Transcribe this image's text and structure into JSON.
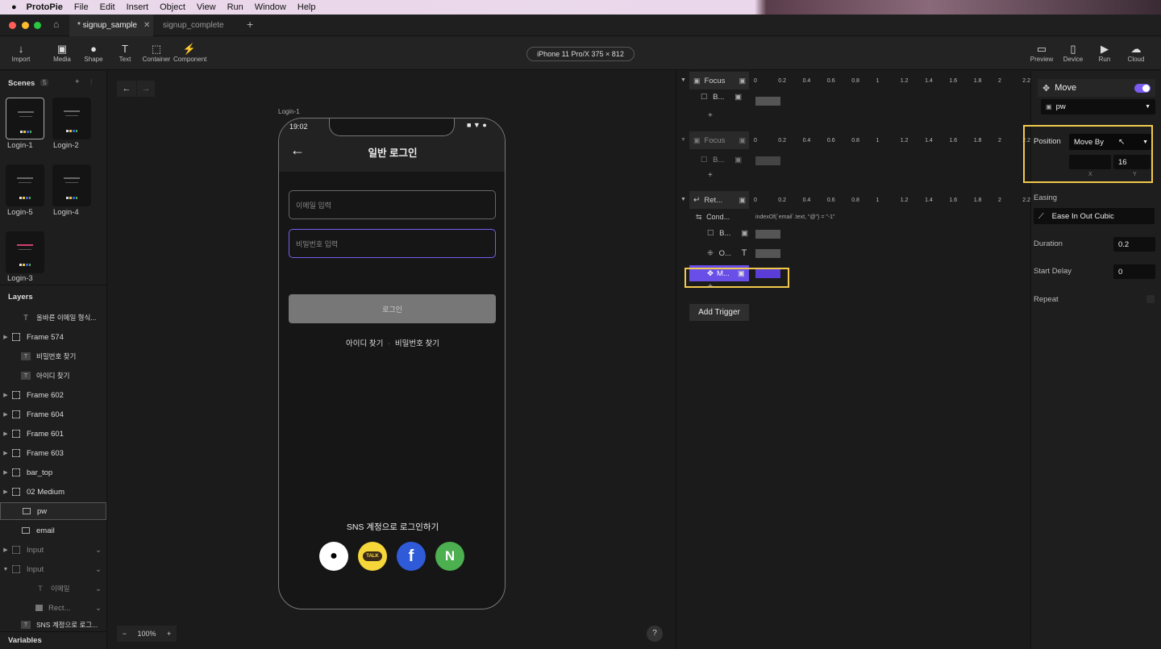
{
  "menubar": {
    "app": "ProtoPie",
    "items": [
      "File",
      "Edit",
      "Insert",
      "Object",
      "View",
      "Run",
      "Window",
      "Help"
    ]
  },
  "tabs": [
    {
      "label": "* signup_sample",
      "active": true
    },
    {
      "label": "signup_complete",
      "active": false
    }
  ],
  "toolbar": {
    "tools": [
      "Import",
      "Media",
      "Shape",
      "Text",
      "Container",
      "Component"
    ],
    "device": "iPhone 11 Pro/X  375 × 812",
    "right_tools": [
      "Preview",
      "Device",
      "Run",
      "Cloud"
    ]
  },
  "scenes": {
    "title": "Scenes",
    "count": "5",
    "items": [
      "Login-1",
      "Login-2",
      "Login-5",
      "Login-4",
      "Login-3"
    ]
  },
  "layers": {
    "title": "Layers",
    "items": [
      "올바른 이메일 형식...",
      "Frame 574",
      "비밀번호 찾기",
      "아이디 찾기",
      "Frame 602",
      "Frame 604",
      "Frame 601",
      "Frame 603",
      "bar_top",
      "02 Medium",
      "pw",
      "email",
      "Input",
      "Input",
      "이메일",
      "Rect...",
      "SNS 계정으로 로그..."
    ]
  },
  "variables_title": "Variables",
  "canvas": {
    "frame_label": "Login-1",
    "zoom": "100%",
    "help": "?",
    "phone": {
      "time": "19:02",
      "back_arrow": "←",
      "title": "일반 로그인",
      "email_placeholder": "이메일 입력",
      "pw_placeholder": "비밀번호 입력",
      "login_button": "로그인",
      "find_id": "아이디 찾기",
      "separator": "·",
      "find_pw": "비밀번호 찾기",
      "sns_title": "SNS 계정으로 로그인하기",
      "kakao": "TALK",
      "facebook": "f",
      "naver": "N"
    }
  },
  "timeline": {
    "ruler": [
      "0",
      "0.2",
      "0.4",
      "0.6",
      "0.8",
      "1",
      "1.2",
      "1.4",
      "1.6",
      "1.8",
      "2",
      "2.2"
    ],
    "focus1": {
      "trigger": "Focus",
      "response": "B..."
    },
    "focus2": {
      "trigger": "Focus",
      "response": "B..."
    },
    "ret": {
      "trigger": "Ret...",
      "condition": "Cond...",
      "condition_text": "indexOf(`email`.text, \"@\") = \"-1\"",
      "r1": "B...",
      "r2": "O...",
      "r3": "M..."
    },
    "add_trigger": "Add Trigger",
    "plus": "+"
  },
  "props": {
    "title": "Move",
    "target": "pw",
    "position_label": "Position",
    "position_mode": "Move By",
    "x_value": "",
    "y_value": "16",
    "x_label": "X",
    "y_label": "Y",
    "easing_label": "Easing",
    "easing_value": "Ease In Out Cubic",
    "duration_label": "Duration",
    "duration_value": "0.2",
    "start_delay_label": "Start Delay",
    "start_delay_value": "0",
    "repeat_label": "Repeat"
  },
  "colors": {
    "accent": "#7a5cf0",
    "highlight": "#f2c94c",
    "kakao": "#f5d73a",
    "facebook": "#2f5bd9",
    "naver": "#4caf50"
  }
}
